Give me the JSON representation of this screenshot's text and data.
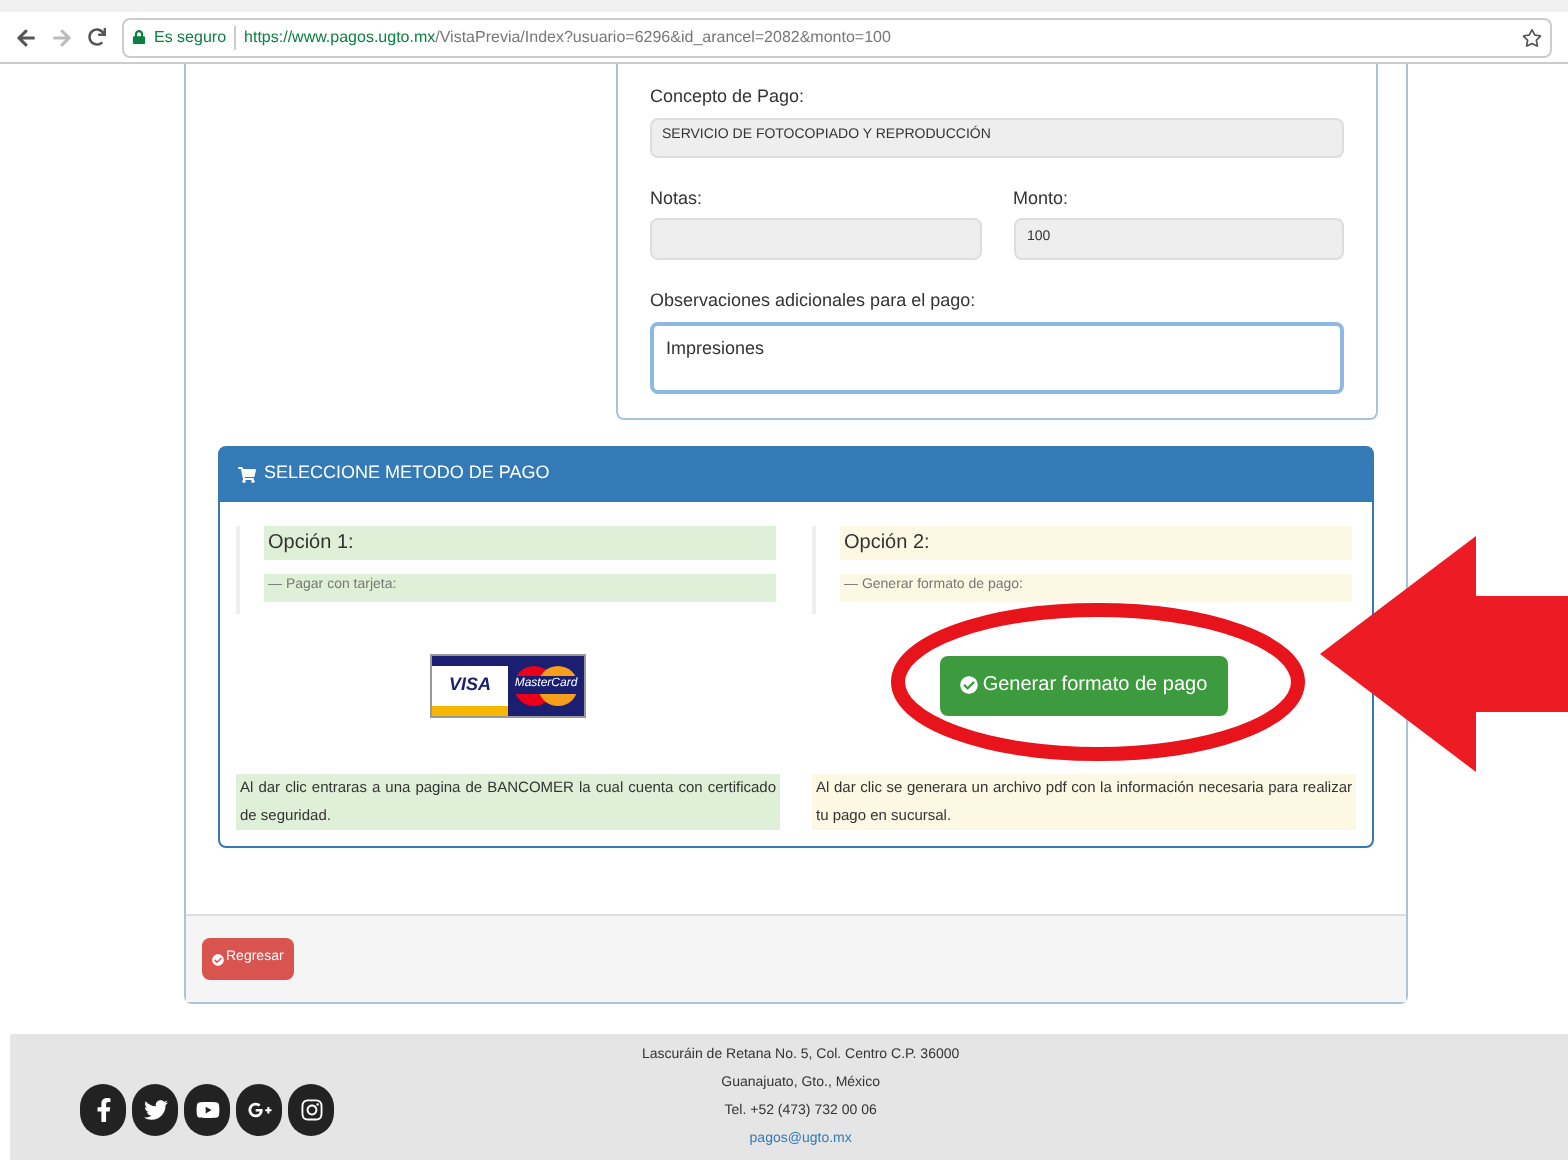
{
  "browser": {
    "secure_label": "Es seguro",
    "url_host": "https://www.pagos.ugto.mx",
    "url_path": "/VistaPrevia/Index?usuario=6296&id_arancel=2082&monto=100"
  },
  "form": {
    "concepto": {
      "label": "Concepto de Pago:",
      "value": "SERVICIO DE FOTOCOPIADO Y REPRODUCCIÓN"
    },
    "notas": {
      "label": "Notas:"
    },
    "monto": {
      "label": "Monto:",
      "value": "100"
    },
    "observaciones": {
      "label": "Observaciones adicionales para el pago:",
      "value": "Impresiones"
    }
  },
  "payment": {
    "title": "SELECCIONE METODO DE PAGO",
    "options": [
      {
        "kind": "card",
        "title": "Opción 1:",
        "subtitle": "— Pagar con tarjeta:",
        "logos": [
          "VISA",
          "MasterCard"
        ],
        "note": "Al dar clic entraras a una pagina de BANCOMER la cual cuenta con certificado de seguridad."
      },
      {
        "kind": "format",
        "title": "Opción 2:",
        "subtitle": "— Generar formato de pago:",
        "button": "Generar formato de pago",
        "note": "Al dar clic se generara un archivo pdf con la información necesaria para realizar tu pago en sucursal."
      }
    ]
  },
  "back_button": "Regresar",
  "footer": {
    "lines": [
      "Lascuráin de Retana No. 5, Col. Centro C.P. 36000",
      "Guanajuato, Gto., México",
      "Tel. +52 (473) 732 00 06"
    ],
    "email": "pagos@ugto.mx"
  }
}
